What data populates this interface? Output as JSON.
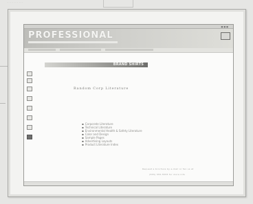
{
  "background": {
    "color": "#e6e6e4"
  },
  "browser": {
    "logo_text": "PROFESSIONAL",
    "nav_label": "BRAND SHIRTS"
  },
  "page": {
    "title": "Random Corp Literature",
    "links": [
      "Corporate Literature",
      "Technical Literature",
      "Environmental Health & Safety Literature",
      "Color and Design",
      "Sample Pages",
      "Advertising Layouts",
      "Product Literature Index"
    ],
    "footer": [
      "Request a brochure by e-mail or fax us at",
      "(555) 555-5555 for more info"
    ]
  },
  "colors": {
    "accent": "#6e6e6b",
    "screen_bg": "#fbfbfa"
  }
}
